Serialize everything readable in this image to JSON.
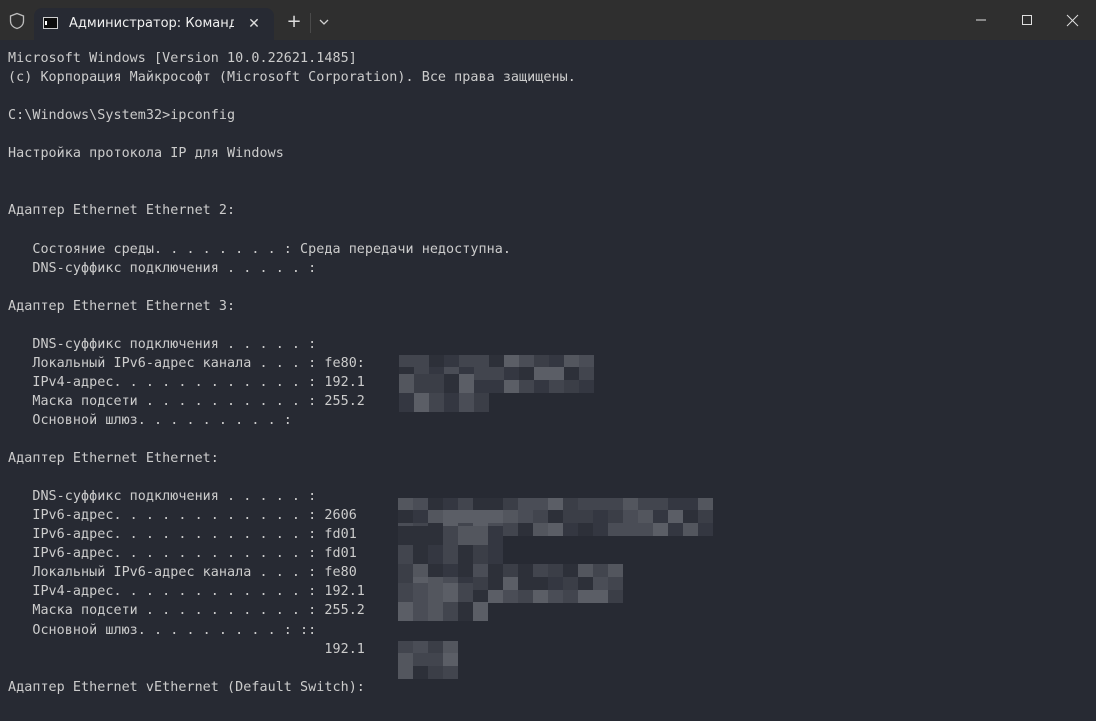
{
  "window": {
    "tab_title": "Администратор: Командна",
    "tab_close_glyph": "✕",
    "new_tab_glyph": "+",
    "controls": {
      "minimize": "minimize",
      "maximize": "maximize",
      "close": "close"
    }
  },
  "terminal": {
    "lines": [
      "Microsoft Windows [Version 10.0.22621.1485]",
      "(c) Корпорация Майкрософт (Microsoft Corporation). Все права защищены.",
      "",
      "C:\\Windows\\System32>ipconfig",
      "",
      "Настройка протокола IP для Windows",
      "",
      "",
      "Адаптер Ethernet Ethernet 2:",
      "",
      "   Состояние среды. . . . . . . . : Среда передачи недоступна.",
      "   DNS-суффикс подключения . . . . . :",
      "",
      "Адаптер Ethernet Ethernet 3:",
      "",
      "   DNS-суффикс подключения . . . . . :",
      "   Локальный IPv6-адрес канала . . . : fe80:",
      "   IPv4-адрес. . . . . . . . . . . . : 192.1",
      "   Маска подсети . . . . . . . . . . : 255.2",
      "   Основной шлюз. . . . . . . . . :",
      "",
      "Адаптер Ethernet Ethernet:",
      "",
      "   DNS-суффикс подключения . . . . . :",
      "   IPv6-адрес. . . . . . . . . . . . : 2606",
      "   IPv6-адрес. . . . . . . . . . . . : fd01",
      "   IPv6-адрес. . . . . . . . . . . . : fd01",
      "   Локальный IPv6-адрес канала . . . : fe80",
      "   IPv4-адрес. . . . . . . . . . . . : 192.1",
      "   Маска подсети . . . . . . . . . . : 255.2",
      "   Основной шлюз. . . . . . . . . : ::",
      "                                       192.1",
      "",
      "Адаптер Ethernet vEthernet (Default Switch):"
    ],
    "redacted_regions": [
      {
        "label": "ethernet3-ipv6-link-local",
        "line": 16
      },
      {
        "label": "ethernet3-ipv4",
        "line": 17
      },
      {
        "label": "ethernet3-subnet-mask",
        "line": 18
      },
      {
        "label": "ethernet-ipv6-1",
        "line": 24
      },
      {
        "label": "ethernet-ipv6-2",
        "line": 25
      },
      {
        "label": "ethernet-ipv6-3",
        "line": 26
      },
      {
        "label": "ethernet-ipv6-link-local",
        "line": 27
      },
      {
        "label": "ethernet-ipv4",
        "line": 28
      },
      {
        "label": "ethernet-subnet-mask",
        "line": 29
      },
      {
        "label": "ethernet-gateway-ipv4",
        "line": 31
      }
    ]
  },
  "colors": {
    "terminal_bg": "#272a33",
    "terminal_fg": "#cccccc",
    "titlebar_bg": "#2f2f2f"
  }
}
